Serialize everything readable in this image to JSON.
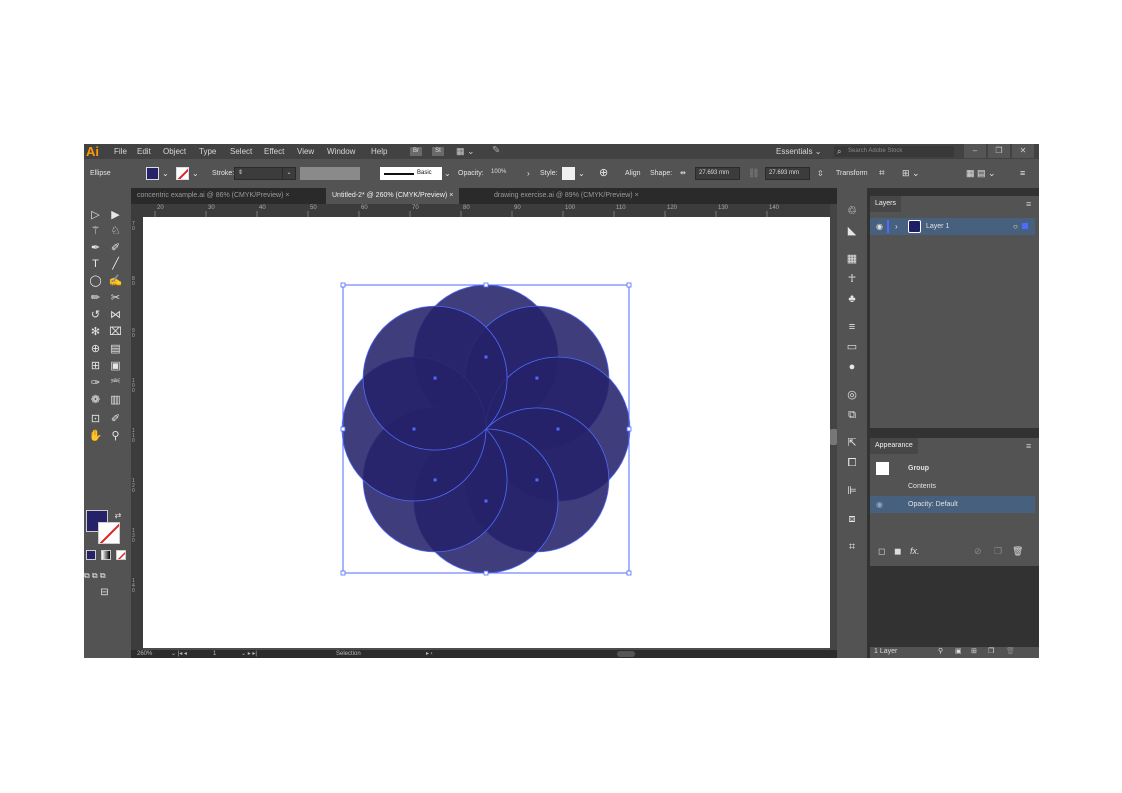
{
  "app": {
    "logo": "Ai",
    "menus": [
      "File",
      "Edit",
      "Object",
      "Type",
      "Select",
      "Effect",
      "View",
      "Window",
      "Help"
    ],
    "bridge_btn": "Br",
    "stock_btn": "St",
    "workspace": "Essentials",
    "search_placeholder": "Search Adobe Stock"
  },
  "control_bar": {
    "selection_type": "Ellipse",
    "stroke_label": "Stroke:",
    "brush_label": "Basic",
    "opacity_label": "Opacity:",
    "opacity_value": "100%",
    "style_label": "Style:",
    "align_label": "Align",
    "shape_label": "Shape:",
    "width_value": "27.693 mm",
    "height_value": "27.693 mm",
    "transform_label": "Transform",
    "fill_color": "#25226a"
  },
  "tabs": [
    {
      "label": "concentric example.ai @ 86% (CMYK/Preview)",
      "close": "×"
    },
    {
      "label": "Untitled-2* @ 260% (CMYK/Preview)",
      "close": "×"
    },
    {
      "label": "drawing exercise.ai @ 89% (CMYK/Preview)",
      "close": "×"
    }
  ],
  "ruler": {
    "h_ticks": [
      "20",
      "30",
      "40",
      "50",
      "60",
      "70",
      "80",
      "90",
      "100",
      "110",
      "120",
      "130",
      "140"
    ],
    "v_ticks": [
      "7 0",
      "8 0",
      "9 0",
      "1 0 0",
      "1 1 0",
      "1 2 0",
      "1 3 0",
      "1 4 0"
    ]
  },
  "status_bar": {
    "zoom": "260%",
    "artboard_num": "1",
    "mode": "Selection"
  },
  "layers_panel": {
    "title": "Layers",
    "layer_name": "Layer 1",
    "footer_count": "1 Layer"
  },
  "appearance_panel": {
    "title": "Appearance",
    "group_label": "Group",
    "contents_label": "Contents",
    "opacity_row": "Opacity: Default",
    "fx_label": "fx."
  },
  "colors": {
    "ui_bg": "#535353",
    "circle_fill": "#25226a",
    "circle_stroke": "#4f6bff",
    "selection": "#4f6bff"
  }
}
